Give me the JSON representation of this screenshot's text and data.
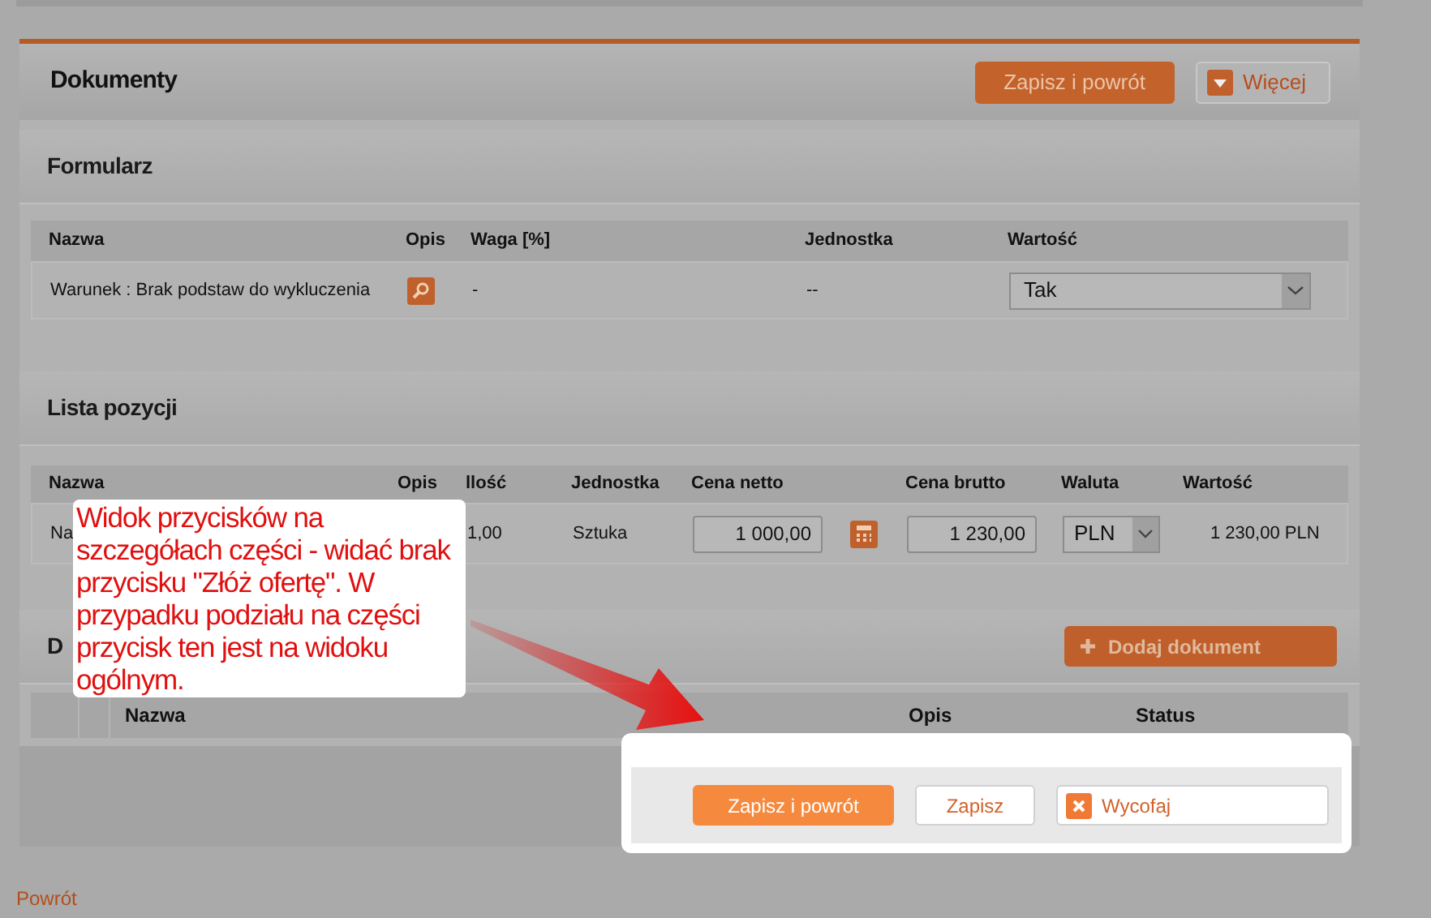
{
  "header": {
    "title": "Dokumenty",
    "buttons": [
      {
        "label": "Zapisz i powrót",
        "kind": "primary"
      },
      {
        "label": "Więcej",
        "kind": "menu"
      }
    ]
  },
  "form": {
    "title": "Formularz",
    "columns": [
      "Nazwa",
      "Opis",
      "Waga [%]",
      "Jednostka",
      "Wartość"
    ],
    "rows": [
      {
        "name": "Warunek : Brak podstaw do wykluczenia",
        "weight": "-",
        "unit": "--",
        "value": "Tak"
      }
    ]
  },
  "items": {
    "title": "Lista pozycji",
    "columns": [
      "Nazwa",
      "Opis",
      "llość",
      "Jednostka",
      "Cena netto",
      "Cena brutto",
      "Waluta",
      "Wartość"
    ],
    "rows": [
      {
        "name": "Na",
        "quantity": "1,00",
        "unit": "Sztuka",
        "net": "1 000,00",
        "gross": "1 230,00",
        "currency": "PLN",
        "value": "1 230,00 PLN"
      }
    ]
  },
  "documents": {
    "title": "D",
    "add_button": "Dodaj dokument",
    "columns": [
      "Nazwa",
      "Opis",
      "Status"
    ]
  },
  "action_bar": {
    "buttons": [
      {
        "label": "Zapisz i powrót",
        "kind": "primary"
      },
      {
        "label": "Zapisz",
        "kind": "secondary"
      },
      {
        "label": "Wycofaj",
        "kind": "cancel"
      }
    ]
  },
  "annotation": {
    "text": "Widok przycisków na szczegółach części - widać brak przycisku \"Złóż ofertę\". W przypadku podziału na części przycisk ten jest na widoku ogólnym."
  },
  "back_link": "Powrót"
}
